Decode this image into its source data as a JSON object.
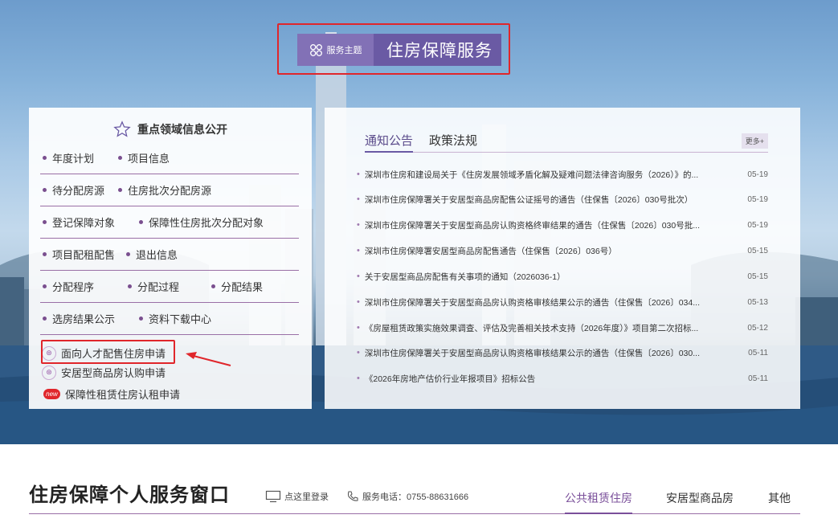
{
  "theme": {
    "tag": "服务主题",
    "title": "住房保障服务"
  },
  "left_panel": {
    "title": "重点领域信息公开",
    "rows": [
      [
        "年度计划",
        "项目信息"
      ],
      [
        "待分配房源",
        "住房批次分配房源"
      ],
      [
        "登记保障对象",
        "保障性住房批次分配对象"
      ],
      [
        "项目配租配售",
        "退出信息"
      ],
      [
        "分配程序",
        "分配过程",
        "分配结果"
      ],
      [
        "选房结果公示",
        "资料下载中心"
      ]
    ],
    "applications": [
      {
        "label": "面向人才配售住房申请",
        "icon": "document-icon"
      },
      {
        "label": "安居型商品房认购申请",
        "icon": "document-icon"
      },
      {
        "label": "保障性租赁住房认租申请",
        "icon": "new-badge",
        "badge": "new"
      }
    ]
  },
  "right_panel": {
    "tabs": [
      "通知公告",
      "政策法规"
    ],
    "more": "更多+",
    "news": [
      {
        "title": "深圳市住房和建设局关于《住房发展领域矛盾化解及疑难问题法律咨询服务（2026）》的...",
        "date": "05-19"
      },
      {
        "title": "深圳市住房保障署关于安居型商品房配售公证摇号的通告（住保售〔2026〕030号批次）",
        "date": "05-19"
      },
      {
        "title": "深圳市住房保障署关于安居型商品房认购资格终审结果的通告（住保售〔2026〕030号批...",
        "date": "05-19"
      },
      {
        "title": "深圳市住房保障署安居型商品房配售通告（住保售〔2026〕036号）",
        "date": "05-15"
      },
      {
        "title": "关于安居型商品房配售有关事项的通知（2026036-1）",
        "date": "05-15"
      },
      {
        "title": "深圳市住房保障署关于安居型商品房认购资格审核结果公示的通告（住保售〔2026〕034...",
        "date": "05-13"
      },
      {
        "title": "《房屋租赁政策实施效果调查、评估及完善相关技术支持（2026年度）》项目第二次招标...",
        "date": "05-12"
      },
      {
        "title": "深圳市住房保障署关于安居型商品房认购资格审核结果公示的通告（住保售〔2026〕030...",
        "date": "05-11"
      },
      {
        "title": "《2026年房地产估价行业年报项目》招标公告",
        "date": "05-11"
      }
    ]
  },
  "bottom": {
    "title": "住房保障个人服务窗口",
    "login": "点这里登录",
    "phone": "服务电话：0755-88631666",
    "tabs": [
      "公共租赁住房",
      "安居型商品房",
      "其他"
    ]
  },
  "colors": {
    "accent": "#6a5aa4",
    "highlight": "#e0262b"
  }
}
